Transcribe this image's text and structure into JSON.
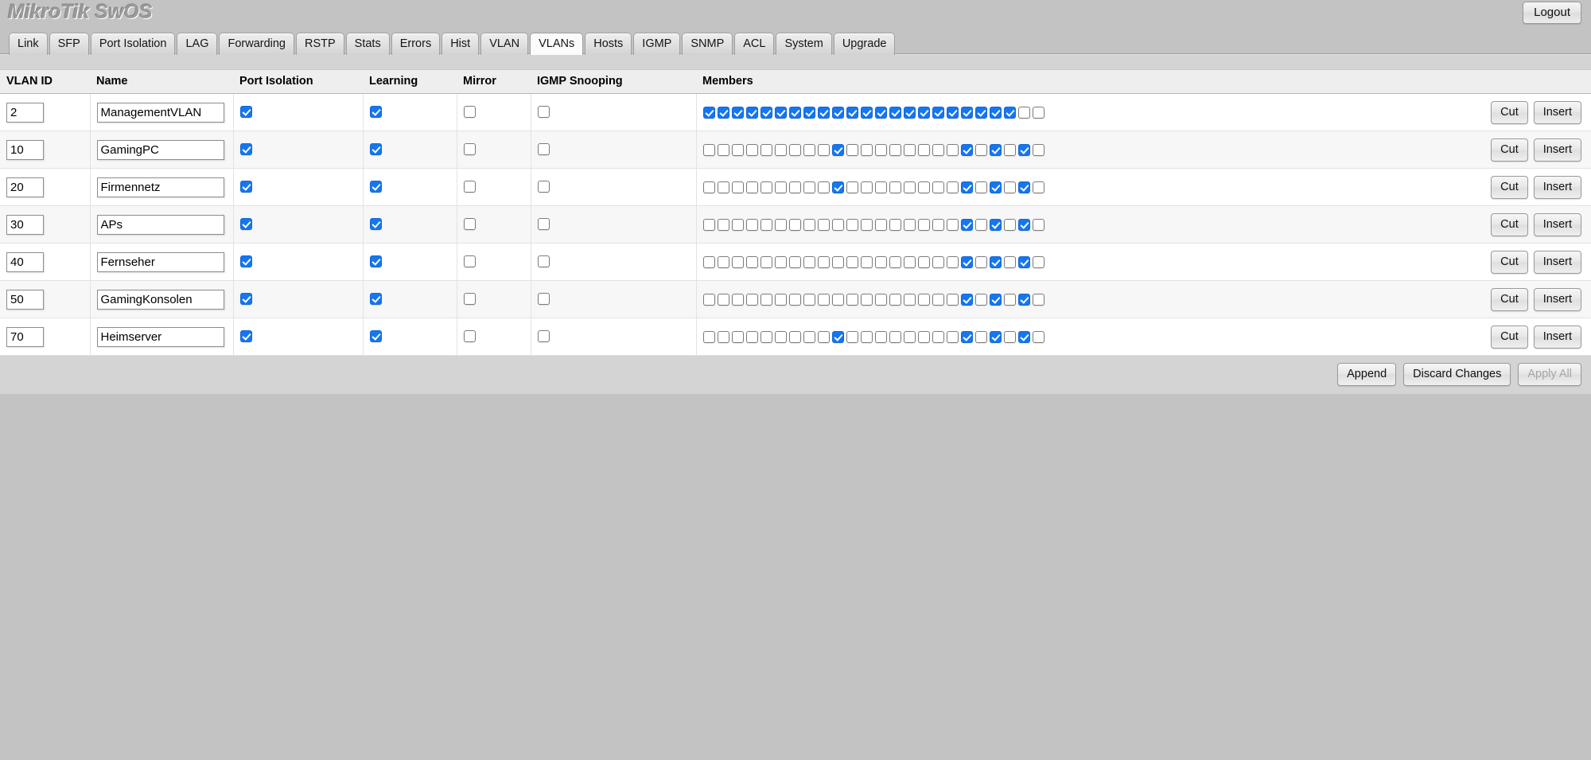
{
  "app": {
    "title": "MikroTik SwOS",
    "logout_label": "Logout"
  },
  "tabs": [
    {
      "label": "Link",
      "active": false
    },
    {
      "label": "SFP",
      "active": false
    },
    {
      "label": "Port Isolation",
      "active": false
    },
    {
      "label": "LAG",
      "active": false
    },
    {
      "label": "Forwarding",
      "active": false
    },
    {
      "label": "RSTP",
      "active": false
    },
    {
      "label": "Stats",
      "active": false
    },
    {
      "label": "Errors",
      "active": false
    },
    {
      "label": "Hist",
      "active": false
    },
    {
      "label": "VLAN",
      "active": false
    },
    {
      "label": "VLANs",
      "active": true
    },
    {
      "label": "Hosts",
      "active": false
    },
    {
      "label": "IGMP",
      "active": false
    },
    {
      "label": "SNMP",
      "active": false
    },
    {
      "label": "ACL",
      "active": false
    },
    {
      "label": "System",
      "active": false
    },
    {
      "label": "Upgrade",
      "active": false
    }
  ],
  "table": {
    "columns": [
      "VLAN ID",
      "Name",
      "Port Isolation",
      "Learning",
      "Mirror",
      "IGMP Snooping",
      "Members",
      ""
    ],
    "row_actions": {
      "cut_label": "Cut",
      "insert_label": "Insert"
    },
    "member_port_count": 24,
    "rows": [
      {
        "vlan_id": "2",
        "name": "ManagementVLAN",
        "port_isolation": true,
        "learning": true,
        "mirror": false,
        "igmp_snooping": false,
        "members": [
          true,
          true,
          true,
          true,
          true,
          true,
          true,
          true,
          true,
          true,
          true,
          true,
          true,
          true,
          true,
          true,
          true,
          true,
          true,
          true,
          true,
          true,
          false,
          false
        ]
      },
      {
        "vlan_id": "10",
        "name": "GamingPC",
        "port_isolation": true,
        "learning": true,
        "mirror": false,
        "igmp_snooping": false,
        "members": [
          false,
          false,
          false,
          false,
          false,
          false,
          false,
          false,
          false,
          true,
          false,
          false,
          false,
          false,
          false,
          false,
          false,
          false,
          true,
          false,
          true,
          false,
          true,
          false
        ]
      },
      {
        "vlan_id": "20",
        "name": "Firmennetz",
        "port_isolation": true,
        "learning": true,
        "mirror": false,
        "igmp_snooping": false,
        "members": [
          false,
          false,
          false,
          false,
          false,
          false,
          false,
          false,
          false,
          true,
          false,
          false,
          false,
          false,
          false,
          false,
          false,
          false,
          true,
          false,
          true,
          false,
          true,
          false
        ]
      },
      {
        "vlan_id": "30",
        "name": "APs",
        "port_isolation": true,
        "learning": true,
        "mirror": false,
        "igmp_snooping": false,
        "members": [
          false,
          false,
          false,
          false,
          false,
          false,
          false,
          false,
          false,
          false,
          false,
          false,
          false,
          false,
          false,
          false,
          false,
          false,
          true,
          false,
          true,
          false,
          true,
          false
        ]
      },
      {
        "vlan_id": "40",
        "name": "Fernseher",
        "port_isolation": true,
        "learning": true,
        "mirror": false,
        "igmp_snooping": false,
        "members": [
          false,
          false,
          false,
          false,
          false,
          false,
          false,
          false,
          false,
          false,
          false,
          false,
          false,
          false,
          false,
          false,
          false,
          false,
          true,
          false,
          true,
          false,
          true,
          false
        ]
      },
      {
        "vlan_id": "50",
        "name": "GamingKonsolen",
        "port_isolation": true,
        "learning": true,
        "mirror": false,
        "igmp_snooping": false,
        "members": [
          false,
          false,
          false,
          false,
          false,
          false,
          false,
          false,
          false,
          false,
          false,
          false,
          false,
          false,
          false,
          false,
          false,
          false,
          true,
          false,
          true,
          false,
          true,
          false
        ]
      },
      {
        "vlan_id": "70",
        "name": "Heimserver",
        "port_isolation": true,
        "learning": true,
        "mirror": false,
        "igmp_snooping": false,
        "members": [
          false,
          false,
          false,
          false,
          false,
          false,
          false,
          false,
          false,
          true,
          false,
          false,
          false,
          false,
          false,
          false,
          false,
          false,
          true,
          false,
          true,
          false,
          true,
          false
        ]
      }
    ]
  },
  "footer": {
    "append_label": "Append",
    "discard_label": "Discard Changes",
    "apply_label": "Apply All",
    "apply_disabled": true
  },
  "colors": {
    "checkbox_on": "#1476f2",
    "page_bg": "#c3c3c3",
    "panel_bg": "#d4d4d4"
  }
}
